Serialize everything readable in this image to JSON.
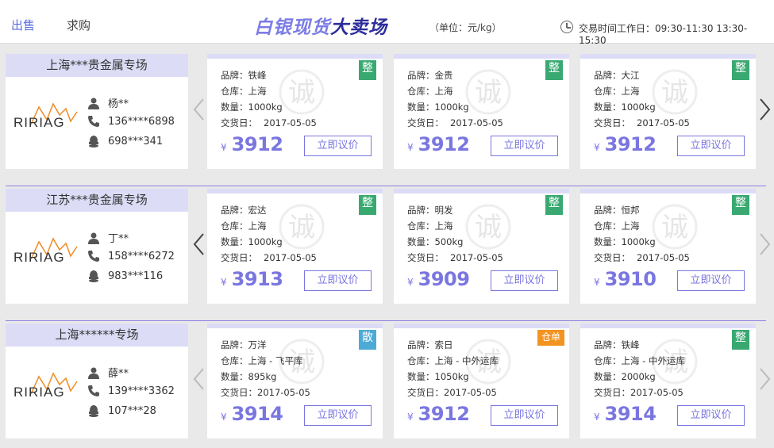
{
  "header": {
    "tabs": [
      {
        "label": "出售",
        "active": true
      },
      {
        "label": "求购",
        "active": false
      }
    ],
    "brand_part1": "白银现货",
    "brand_part2": "大卖场",
    "unit": "（单位：元/kg）",
    "hours": "交易时间工作日：09:30-11:30  13:30-15:30"
  },
  "labels": {
    "brand": "品牌：",
    "warehouse": "仓库：",
    "quantity": "数量：",
    "delivery": "交货日：",
    "yen": "¥",
    "button": "立即议价",
    "watermark": "诚"
  },
  "colors": {
    "accent": "#7a76e0",
    "badge_zheng": "#39a971",
    "badge_san": "#4daad6",
    "badge_cangdan": "#f39421"
  },
  "rows": [
    {
      "shop_title": "上海***贵金属专场",
      "logo": "RIRIAG",
      "contact_name": "杨**",
      "phone": "136****6898",
      "qq": "698***341",
      "cards": [
        {
          "brand": "铁峰",
          "warehouse": "上海",
          "quantity": "1000kg",
          "delivery": "2017-05-05",
          "price": "3912",
          "badge": "整",
          "badge_type": "green"
        },
        {
          "brand": "金贵",
          "warehouse": "上海",
          "quantity": "1000kg",
          "delivery": "2017-05-05",
          "price": "3912",
          "badge": "整",
          "badge_type": "green"
        },
        {
          "brand": "大江",
          "warehouse": "上海",
          "quantity": "1000kg",
          "delivery": "2017-05-05",
          "price": "3912",
          "badge": "整",
          "badge_type": "green"
        }
      ]
    },
    {
      "shop_title": "江苏***贵金属专场",
      "logo": "RIRIAG",
      "contact_name": "丁**",
      "phone": "158****6272",
      "qq": "983***116",
      "cards": [
        {
          "brand": "宏达",
          "warehouse": "上海",
          "quantity": "1000kg",
          "delivery": "2017-05-05",
          "price": "3913",
          "badge": "整",
          "badge_type": "green"
        },
        {
          "brand": "明发",
          "warehouse": "上海",
          "quantity": "500kg",
          "delivery": "2017-05-05",
          "price": "3909",
          "badge": "整",
          "badge_type": "green"
        },
        {
          "brand": "恒邦",
          "warehouse": "上海",
          "quantity": "1000kg",
          "delivery": "2017-05-05",
          "price": "3910",
          "badge": "整",
          "badge_type": "green"
        }
      ]
    },
    {
      "shop_title": "上海******专场",
      "logo": "RIRIAG",
      "contact_name": "薛**",
      "phone": "139****3362",
      "qq": "107***28",
      "cards": [
        {
          "brand": "万洋",
          "warehouse": "上海 - 飞平库",
          "quantity": "895kg",
          "delivery": "2017-05-05",
          "price": "3914",
          "badge": "散",
          "badge_type": "blue"
        },
        {
          "brand": "索日",
          "warehouse": "上海 - 中外运库",
          "quantity": "1050kg",
          "delivery": "2017-05-05",
          "price": "3912",
          "badge": "仓单",
          "badge_type": "orange"
        },
        {
          "brand": "铁峰",
          "warehouse": "上海 - 中外运库",
          "quantity": "2000kg",
          "delivery": "2017-05-05",
          "price": "3914",
          "badge": "整",
          "badge_type": "green"
        }
      ]
    }
  ]
}
